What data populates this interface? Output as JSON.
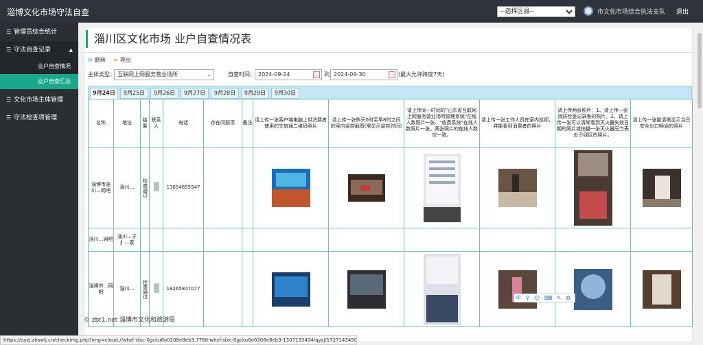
{
  "app": {
    "title": "淄博文化市场守法自查",
    "district_select": "--选择区县--",
    "org_name": "市文化市场综合执法支队",
    "logout": "退出"
  },
  "sidebar": {
    "items": [
      {
        "label": "管理员综合统计",
        "icon": "list-icon"
      },
      {
        "label": "守法自查记录",
        "icon": "list-icon",
        "expanded": true,
        "children": [
          {
            "label": "业户自查情况",
            "active": false
          },
          {
            "label": "业户自查汇总",
            "active": true
          }
        ]
      },
      {
        "label": "文化市场主体管理",
        "icon": "list-icon"
      },
      {
        "label": "守法检查项管理",
        "icon": "list-icon"
      }
    ]
  },
  "page": {
    "title": "淄川区文化市场 业户自查情况表"
  },
  "toolbar": {
    "refresh": "刷新",
    "export": "导出"
  },
  "filter": {
    "type_label": "主体类型：",
    "type_value": "互联网上网服务营业场所",
    "time_label": "自查时间：",
    "start": "2024-09-24",
    "to": "到",
    "end": "2024-09-30",
    "hint": "(最大允许跨度7天)"
  },
  "tabs": [
    "9月24日",
    "9月25日",
    "9月26日",
    "9月27日",
    "9月28日",
    "9月29日",
    "9月30日"
  ],
  "table": {
    "headers": [
      "名称",
      "地址",
      "结果",
      "联系人",
      "电话",
      "存在问题项",
      "备注",
      "请上传一张客户端电脑上供消费者使用的文旅通二维码照片",
      "请上传一张昨天0时至早8时之间的室内监控截图(需显示监控时间)",
      "请上传同一时间的\"山东省互联网上网服务营业场所管理系统\"在线人数照片一张、\"收费系统\"在线人数照片一张。两张照片的在线人数应一致。",
      "请上传一张工作人员在室内巡视，并能看到消费者的照片",
      "请上传两张照片：1、请上传一张消防检查记录表的照片。2、请上传一张可以清晰看到灭火器失效日期的照片或拍摄一张灭火器压力表处于绿区的照片。",
      "请上传一张能清晰显示当日安全出口畅通的照片"
    ],
    "rows": [
      {
        "name": "淄博市淄川…网吧",
        "addr": "淄川…",
        "result": "检查通过",
        "phone": "13054855547"
      },
      {
        "name": "淄川…网吧",
        "addr": "淄川…子扌…家",
        "result": "",
        "phone": ""
      },
      {
        "name": "淄博市…网吧",
        "addr": "淄川…",
        "result": "检查通过",
        "phone": "18265847077"
      }
    ]
  },
  "footer": {
    "text": "© zbt1.net   淄博市文化和旅游局"
  },
  "ime": "中 ⚲ ☺ ⌨ ✎ ⚙",
  "statusbar": "https://qyzj.zbswlj.cn/checkimg.php?img=cloud://whzf-sfzc-0gcku8o0208e8eb3.7768-whzf-sfzc-0gcku8o0208e8eb3-1307133434/qyzj/1727143450030-0.jpg"
}
